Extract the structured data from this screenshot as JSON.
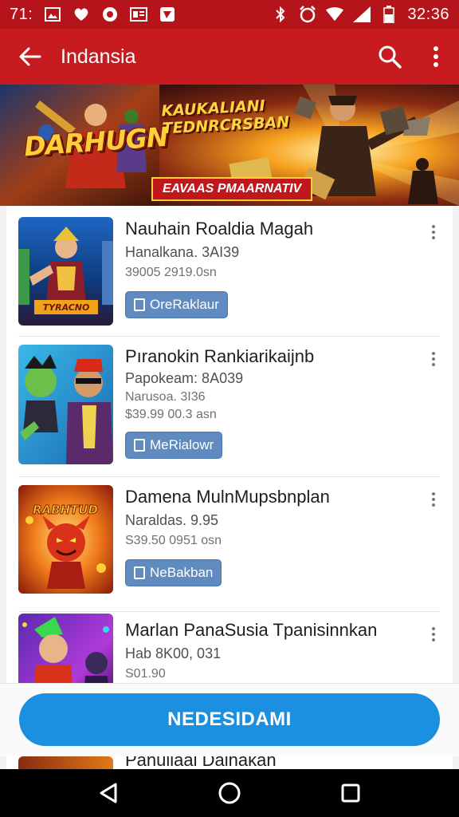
{
  "status_bar": {
    "time": "32:36",
    "left_text": "71:",
    "icons_left": [
      "image-icon",
      "heart-icon",
      "record-icon",
      "news-icon",
      "photo-icon"
    ],
    "icons_right": [
      "bluetooth-icon",
      "alarm-icon",
      "wifi-icon",
      "signal-icon",
      "battery-icon"
    ]
  },
  "app_bar": {
    "title": "Indansia",
    "back_icon": "arrow-left-icon",
    "search_icon": "search-icon",
    "menu_icon": "more-vertical-icon"
  },
  "banner": {
    "logo_text": "DARHUGN",
    "headline": "KAUKALIANI TEDNRCRSBAN",
    "pill_text": "EAVAAS PMAARNATIV"
  },
  "list": [
    {
      "name": "Nauhain Roaldia Magah",
      "subtitle": "Hanalkana. 3AI39",
      "meta_lines": [
        "39005 2919.0sn"
      ],
      "button_label": "OreRaklaur",
      "theme": "blue"
    },
    {
      "name": "Pıranokin Rankiarikaijnb",
      "subtitle": "Papokeam: 8A039",
      "meta_lines": [
        "Narusoa. 3I36",
        "$39.99 00.3 asn"
      ],
      "button_label": "MeRialowr",
      "theme": "cyan"
    },
    {
      "name": "Damena MulnMupsbnplan",
      "subtitle": "Naraldas. 9.95",
      "meta_lines": [
        "S39.50 0951 osn"
      ],
      "button_label": "NeBakban",
      "theme": "orange"
    },
    {
      "name": "Marlan PanaSusia Tpanisinnkan",
      "subtitle": "Hab 8K00, 031",
      "meta_lines": [
        "S01.90"
      ],
      "button_label": "",
      "theme": "purple"
    }
  ],
  "peek_item": {
    "name": "Panuliaal Dainakan"
  },
  "primary_button": {
    "label": "NEDESIDAMI"
  },
  "nav_bar": {
    "back_icon": "triangle-back-icon",
    "home_icon": "circle-home-icon",
    "recents_icon": "square-recents-icon"
  },
  "colors": {
    "status_bar": "#b5141a",
    "app_bar": "#c81b20",
    "primary_button": "#1b8fe0",
    "item_button": "#5f8bc0"
  }
}
